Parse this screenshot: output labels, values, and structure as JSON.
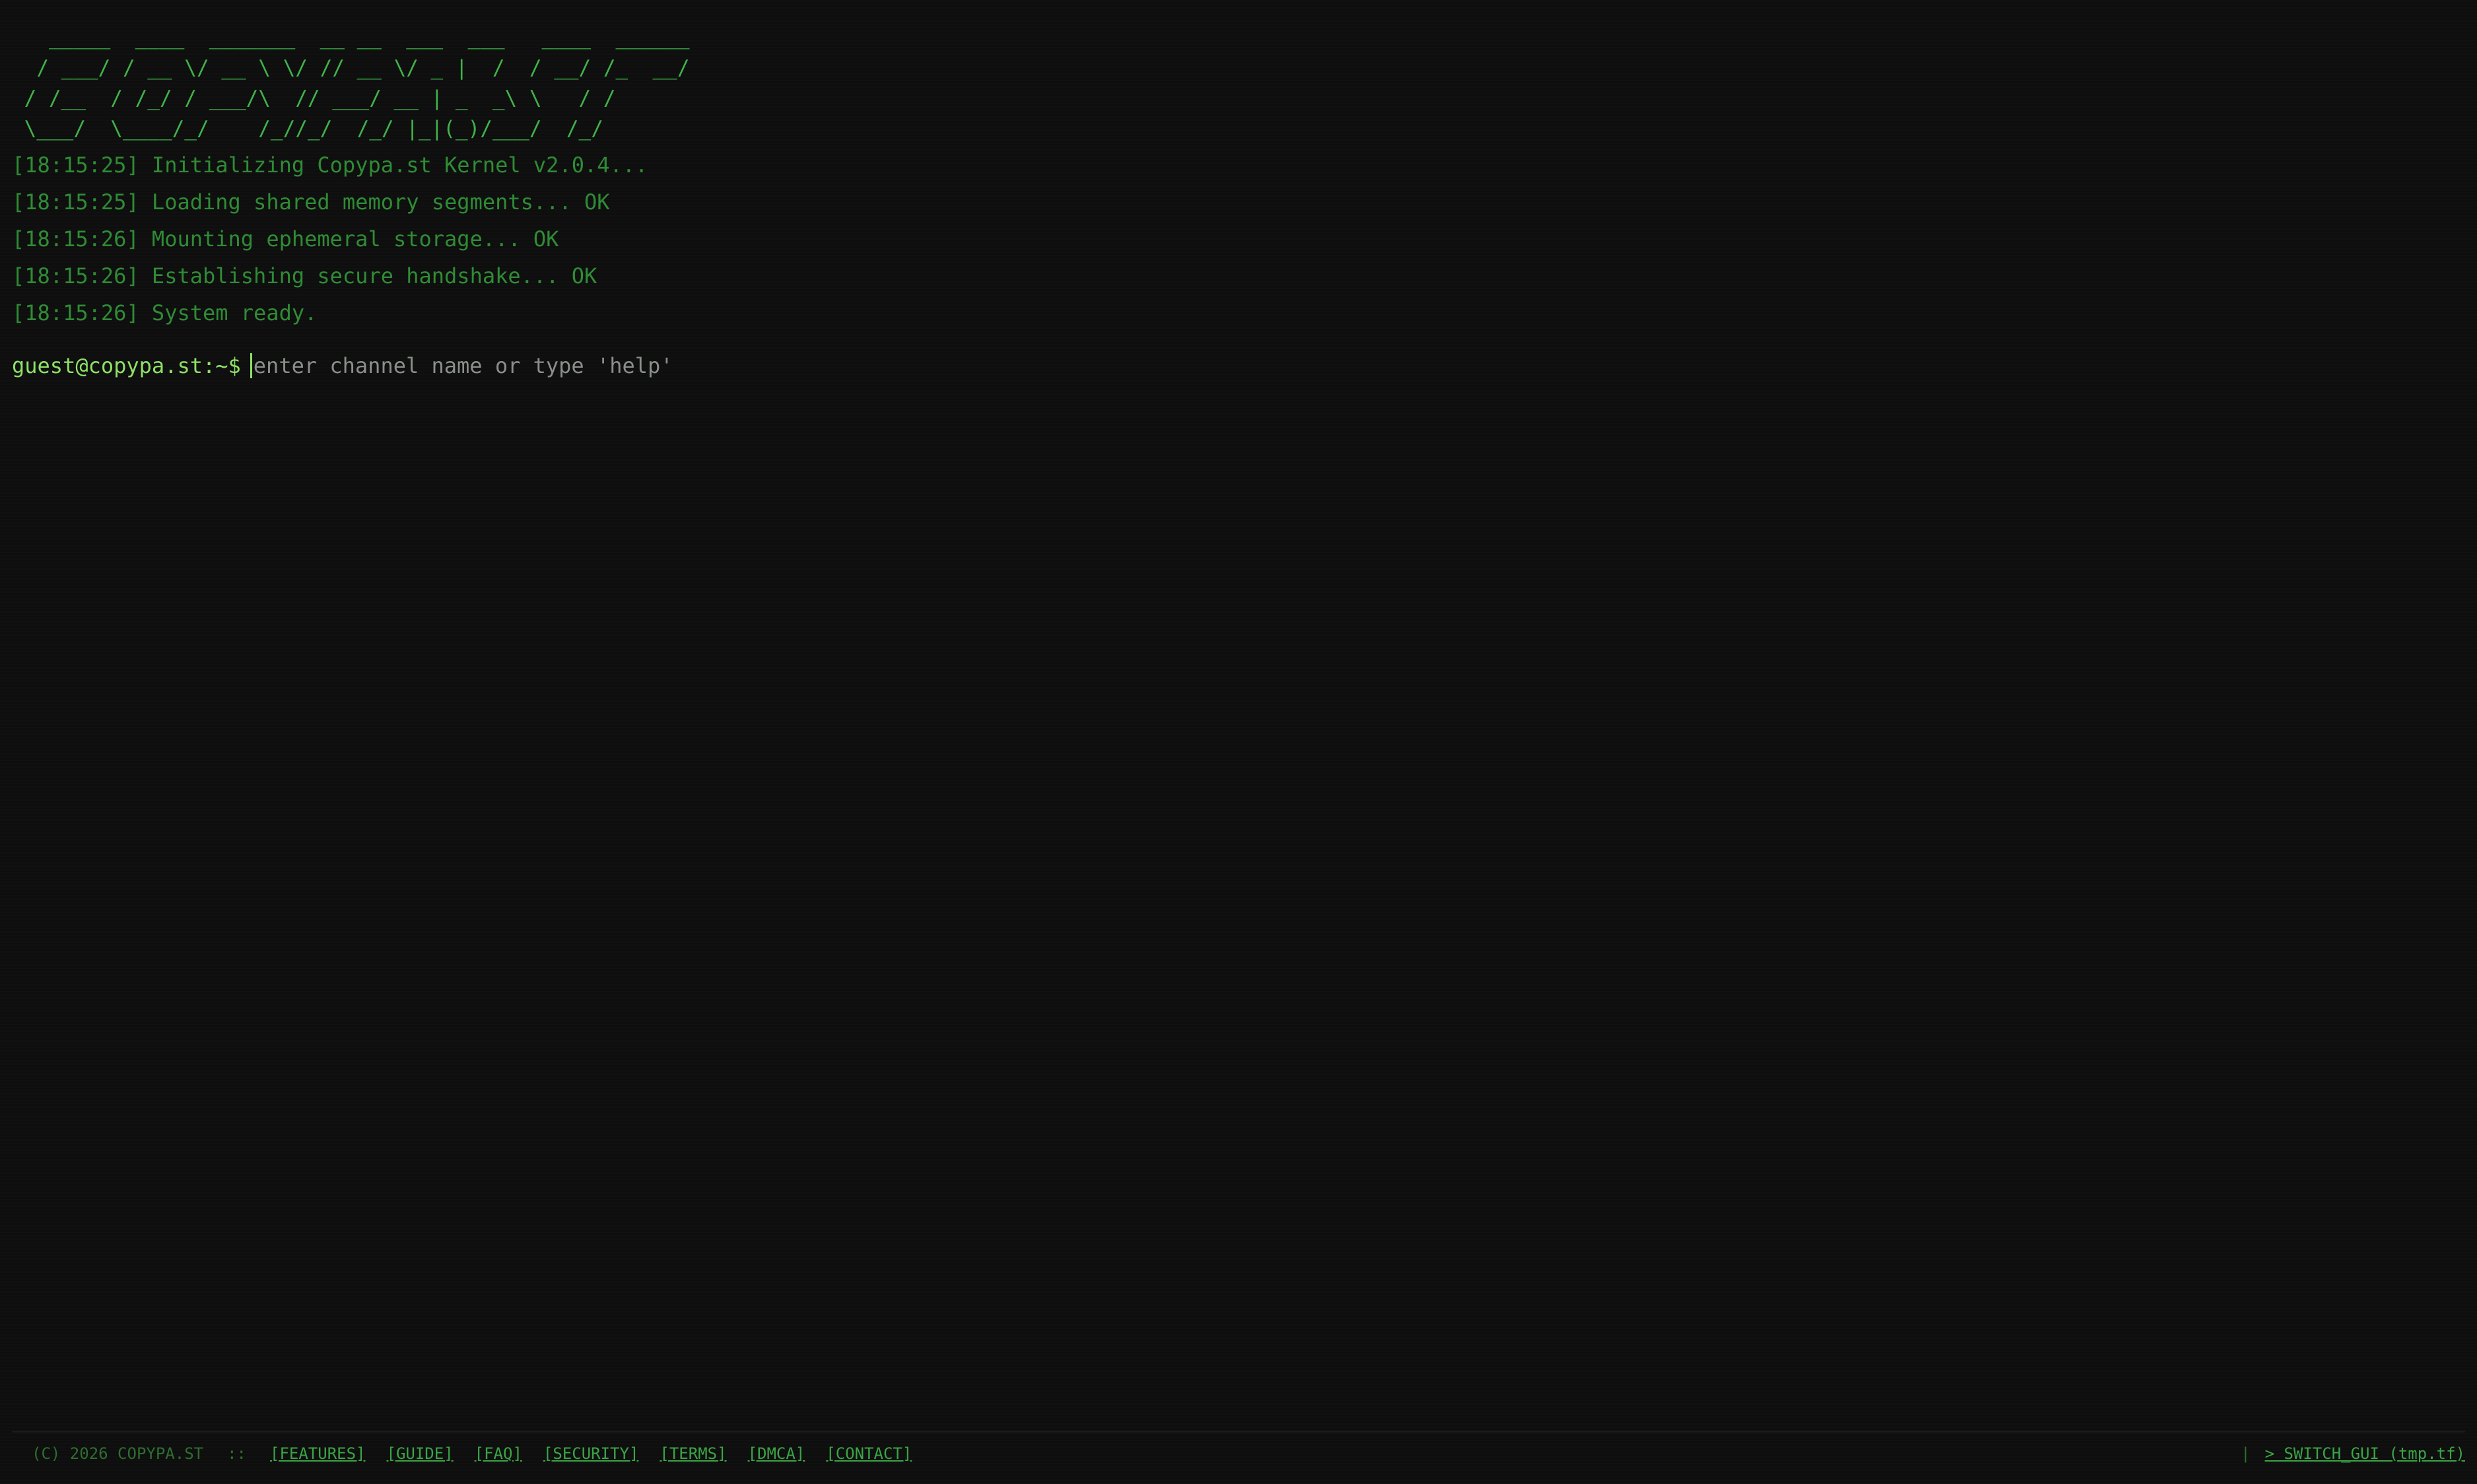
{
  "banner": {
    "ascii": "   _____  ____  _______  __ __  ___  ___   ____  ______\n  / ___/ / __ \\/ __ \\ \\/ // __ \\/ _ |  /  / __/ /_  __/\n / /__  / /_/ / ___/\\  // ___/ __ | _  _\\ \\   / /   \n \\___/  \\____/_/    /_//_/  /_/ |_|(_)/___/  /_/    "
  },
  "log": [
    "[18:15:25] Initializing Copypa.st Kernel v2.0.4...",
    "[18:15:25] Loading shared memory segments... OK",
    "[18:15:26] Mounting ephemeral storage... OK",
    "[18:15:26] Establishing secure handshake... OK",
    "[18:15:26] System ready."
  ],
  "prompt": {
    "label": "guest@copypa.st:~$",
    "placeholder": "enter channel name or type 'help'",
    "value": ""
  },
  "footer": {
    "copyright": "(C) 2026 COPYPA.ST",
    "separator": "::",
    "links": [
      "[FEATURES]",
      "[GUIDE]",
      "[FAQ]",
      "[SECURITY]",
      "[TERMS]",
      "[DMCA]",
      "[CONTACT]"
    ],
    "pipe": "|",
    "switch_gui": "> SWITCH_GUI (tmp.tf)"
  },
  "colors": {
    "background": "#0e0e0e",
    "log_text": "#2f8c35",
    "prompt": "#8fe066",
    "banner": "#3fb34a"
  }
}
